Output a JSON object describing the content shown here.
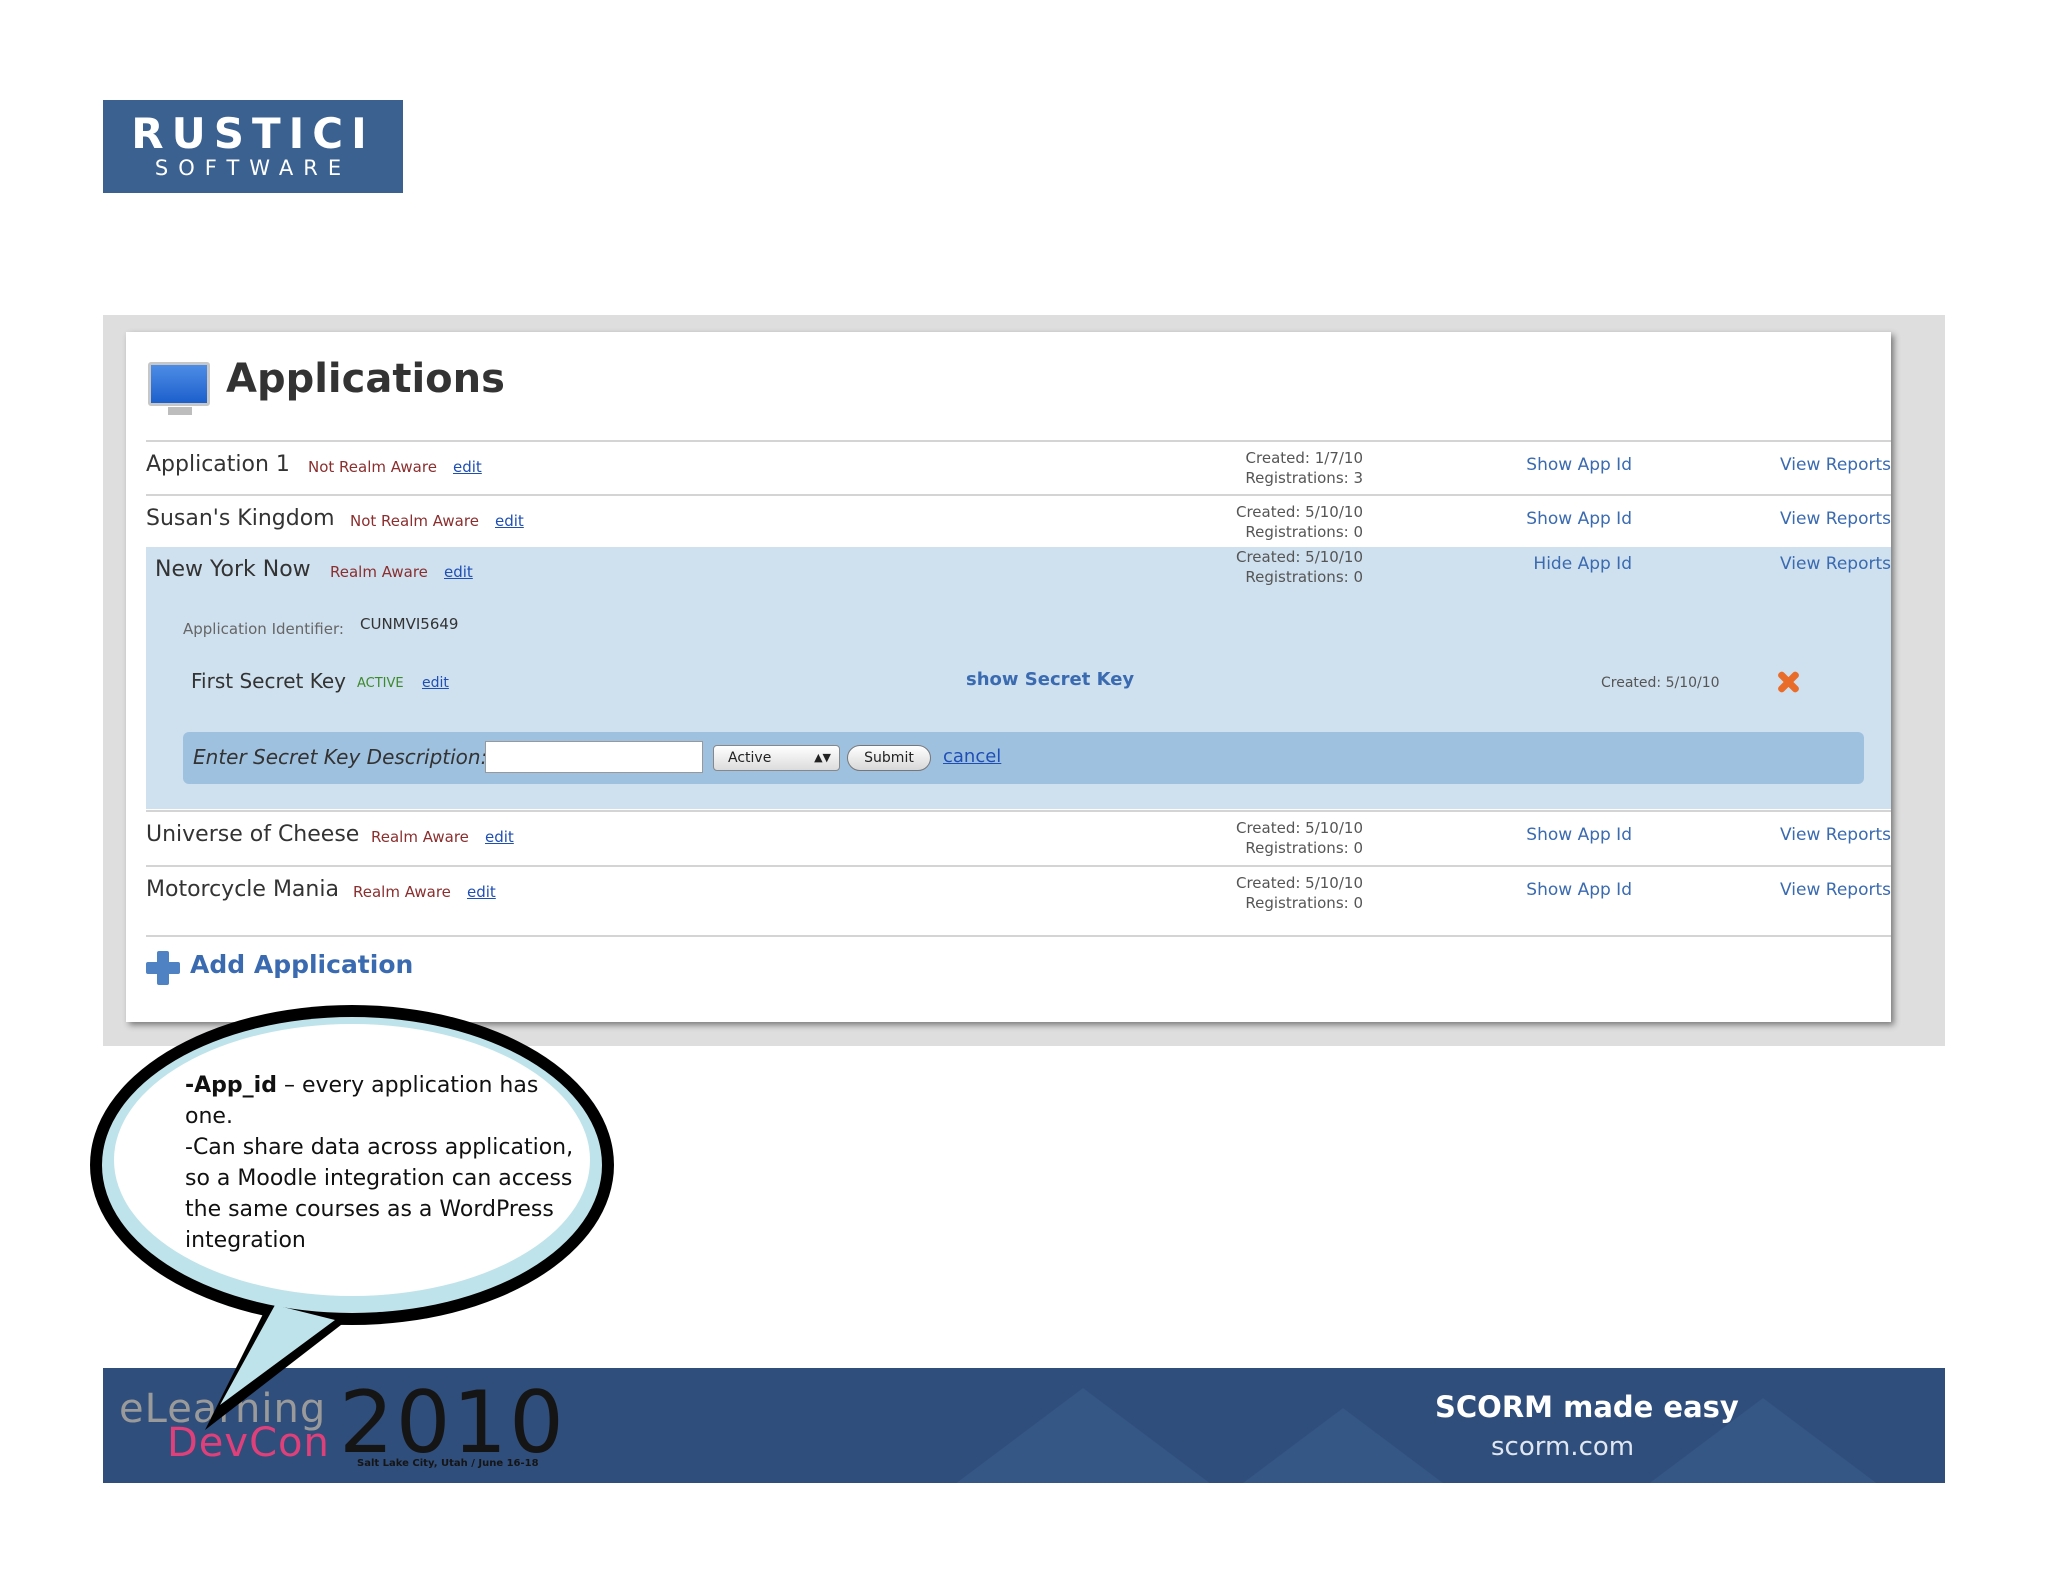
{
  "logo": {
    "main": "RUSTICI",
    "sub": "SOFTWARE"
  },
  "page": {
    "title": "Applications",
    "title_icon": "monitor-icon"
  },
  "applications": [
    {
      "name": "Application 1",
      "realm": "Not Realm Aware",
      "edit": "edit",
      "created": "Created: 1/7/10",
      "registrations": "Registrations: 3",
      "toggle": "Show App Id",
      "reports": "View Reports"
    },
    {
      "name": "Susan's Kingdom",
      "realm": "Not Realm Aware",
      "edit": "edit",
      "created": "Created: 5/10/10",
      "registrations": "Registrations: 0",
      "toggle": "Show App Id",
      "reports": "View Reports"
    },
    {
      "name": "New York Now",
      "realm": "Realm Aware",
      "edit": "edit",
      "created": "Created: 5/10/10",
      "registrations": "Registrations: 0",
      "toggle": "Hide App Id",
      "reports": "View Reports"
    },
    {
      "name": "Universe of Cheese",
      "realm": "Realm Aware",
      "edit": "edit",
      "created": "Created: 5/10/10",
      "registrations": "Registrations: 0",
      "toggle": "Show App Id",
      "reports": "View Reports"
    },
    {
      "name": "Motorcycle Mania",
      "realm": "Realm Aware",
      "edit": "edit",
      "created": "Created: 5/10/10",
      "registrations": "Registrations: 0",
      "toggle": "Show App Id",
      "reports": "View Reports"
    }
  ],
  "expanded": {
    "identifier_label": "Application Identifier:",
    "identifier_value": "CUNMVI5649",
    "key": {
      "name": "First Secret Key",
      "status": "ACTIVE",
      "edit": "edit",
      "show_secret": "show Secret Key",
      "created": "Created: 5/10/10",
      "delete_icon": "delete-x-icon"
    },
    "form": {
      "label": "Enter Secret Key Description:",
      "input_value": "",
      "input_placeholder": "",
      "select_value": "Active",
      "submit": "Submit",
      "cancel": "cancel"
    }
  },
  "add_application": {
    "label": "Add Application",
    "icon": "plus-icon"
  },
  "callout": {
    "bold": "-App_id",
    "line1": " – every application has one.",
    "line2": "-Can share data across application, so a Moodle integration can access the same courses as a WordPress integration"
  },
  "footer": {
    "elearning": "eLearning",
    "devcon": "DevCon",
    "year": "2010",
    "location": "Salt Lake City, Utah / June 16-18",
    "tagline": "SCORM made easy",
    "site": "scorm.com"
  },
  "colors": {
    "brand": "#3b6191",
    "link": "#3a6ab0",
    "expanded_bg": "#cfe0ef",
    "form_bg": "#9fc1e0",
    "footer_bg": "#2f4e7c",
    "devcon_pink": "#e0407a"
  }
}
